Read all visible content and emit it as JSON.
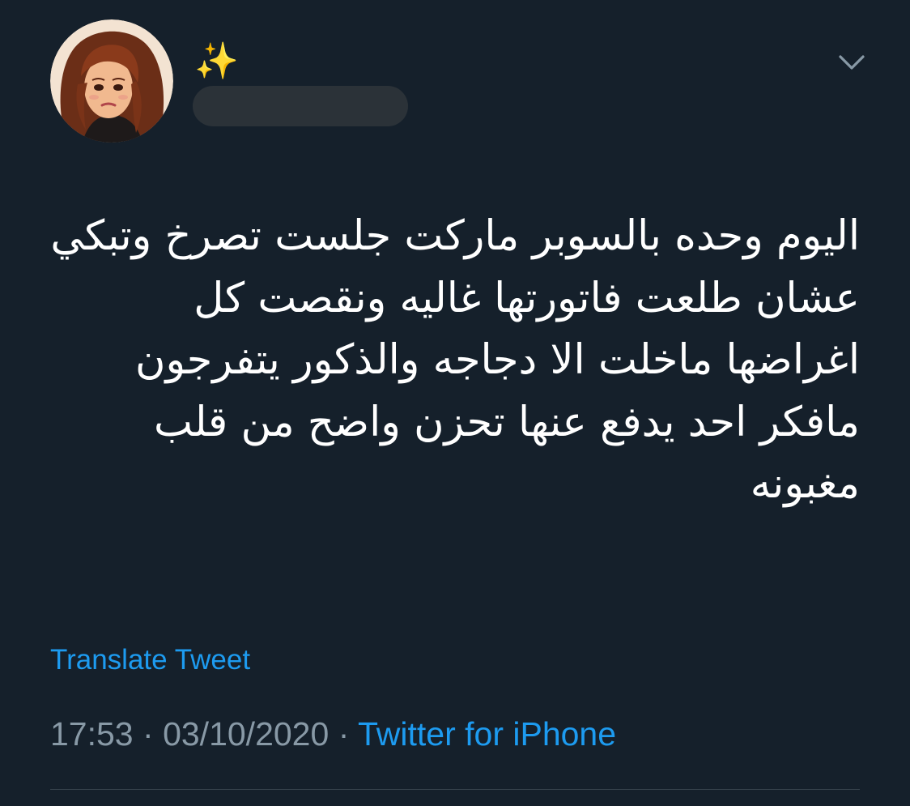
{
  "tweet": {
    "display_name": "✨",
    "text": "اليوم وحده بالسوبر ماركت جلست تصرخ وتبكي عشان طلعت فاتورتها غاليه ونقصت كل اغراضها ماخلت الا دجاجه والذكور يتفرجون مافكر احد يدفع عنها تحزن واضح من قلب مغبونه",
    "translate_label": "Translate Tweet",
    "time": "17:53",
    "date": "03/10/2020",
    "separator": "·",
    "source": "Twitter for iPhone"
  },
  "icons": {
    "menu": "chevron-down-icon",
    "avatar": "avatar-illustration"
  },
  "colors": {
    "background": "#15202b",
    "text": "#ffffff",
    "link": "#1d9bf0",
    "muted": "#8899a6",
    "divider": "#38444d"
  }
}
